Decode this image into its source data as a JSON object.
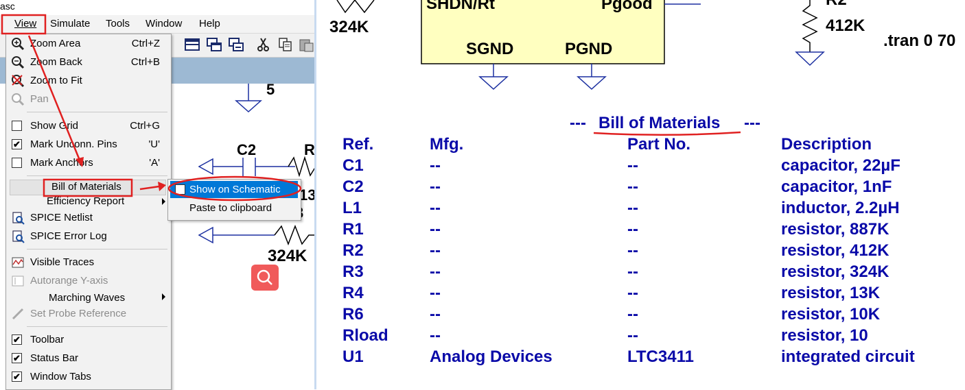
{
  "window": {
    "title": "asc"
  },
  "menubar": {
    "items": [
      {
        "label": "View",
        "underline_index": 0
      },
      {
        "label": "Simulate",
        "underline_index": 0
      },
      {
        "label": "Tools",
        "underline_index": 0
      },
      {
        "label": "Window",
        "underline_index": 0
      },
      {
        "label": "Help",
        "underline_index": 0
      }
    ]
  },
  "view_menu": {
    "zoom_area": {
      "label": "Zoom Area",
      "shortcut": "Ctrl+Z"
    },
    "zoom_back": {
      "label": "Zoom Back",
      "shortcut": "Ctrl+B"
    },
    "zoom_fit": {
      "label": "Zoom to Fit"
    },
    "pan": {
      "label": "Pan"
    },
    "show_grid": {
      "label": "Show Grid",
      "shortcut": "Ctrl+G",
      "checked": false
    },
    "mark_unconn": {
      "label": "Mark Unconn. Pins",
      "shortcut": "'U'",
      "checked": true
    },
    "mark_anchors": {
      "label": "Mark Anchors",
      "shortcut": "'A'",
      "checked": false
    },
    "bom": {
      "label": "Bill of Materials"
    },
    "efficiency": {
      "label": "Efficiency Report"
    },
    "spice_netlist": {
      "label": "SPICE Netlist"
    },
    "spice_error": {
      "label": "SPICE Error Log"
    },
    "visible_traces": {
      "label": "Visible Traces"
    },
    "autorange": {
      "label": "Autorange Y-axis"
    },
    "marching": {
      "label": "Marching Waves"
    },
    "probe_ref": {
      "label": "Set Probe Reference"
    },
    "toolbar": {
      "label": "Toolbar",
      "checked": true
    },
    "status_bar": {
      "label": "Status Bar",
      "checked": true
    },
    "window_tabs": {
      "label": "Window Tabs",
      "checked": true
    }
  },
  "bom_submenu": {
    "show_on_schematic": {
      "label": "Show on Schematic",
      "checked": false
    },
    "paste": {
      "label": "Paste to clipboard"
    }
  },
  "left_schematic": {
    "num5": "5",
    "c2": "C2",
    "r_partial": "R",
    "partial13": "13",
    "partial3": "3",
    "r324k": "324K"
  },
  "right_schematic": {
    "r324k": "324K",
    "shdn": "SHDN/Rt",
    "pgood": "Pgood",
    "sgnd": "SGND",
    "pgnd": "PGND",
    "r2_partial": "R2",
    "r412k": "412K",
    "tran": ".tran 0 70"
  },
  "bom_table": {
    "title_prefix": "---",
    "title": "Bill of Materials",
    "title_suffix": "---",
    "headers": {
      "ref": "Ref.",
      "mfg": "Mfg.",
      "part": "Part No.",
      "desc": "Description"
    },
    "rows": [
      {
        "ref": "C1",
        "mfg": "--",
        "part": "--",
        "desc": "capacitor, 22µF"
      },
      {
        "ref": "C2",
        "mfg": "--",
        "part": "--",
        "desc": "capacitor, 1nF"
      },
      {
        "ref": "L1",
        "mfg": "--",
        "part": "--",
        "desc": "inductor, 2.2µH"
      },
      {
        "ref": "R1",
        "mfg": "--",
        "part": "--",
        "desc": "resistor, 887K"
      },
      {
        "ref": "R2",
        "mfg": "--",
        "part": "--",
        "desc": "resistor, 412K"
      },
      {
        "ref": "R3",
        "mfg": "--",
        "part": "--",
        "desc": "resistor, 324K"
      },
      {
        "ref": "R4",
        "mfg": "--",
        "part": "--",
        "desc": "resistor, 13K"
      },
      {
        "ref": "R6",
        "mfg": "--",
        "part": "--",
        "desc": "resistor, 10K"
      },
      {
        "ref": "Rload",
        "mfg": "--",
        "part": "--",
        "desc": "resistor, 10"
      },
      {
        "ref": "U1",
        "mfg": "Analog Devices",
        "part": "LTC3411",
        "desc": "integrated circuit"
      }
    ]
  },
  "colors": {
    "bom_text": "#0a0aa8",
    "annotation_red": "#e02020",
    "highlight_blue": "#0078d7",
    "ic_fill": "#ffffc0",
    "wire_blue": "#1b2fa0"
  }
}
